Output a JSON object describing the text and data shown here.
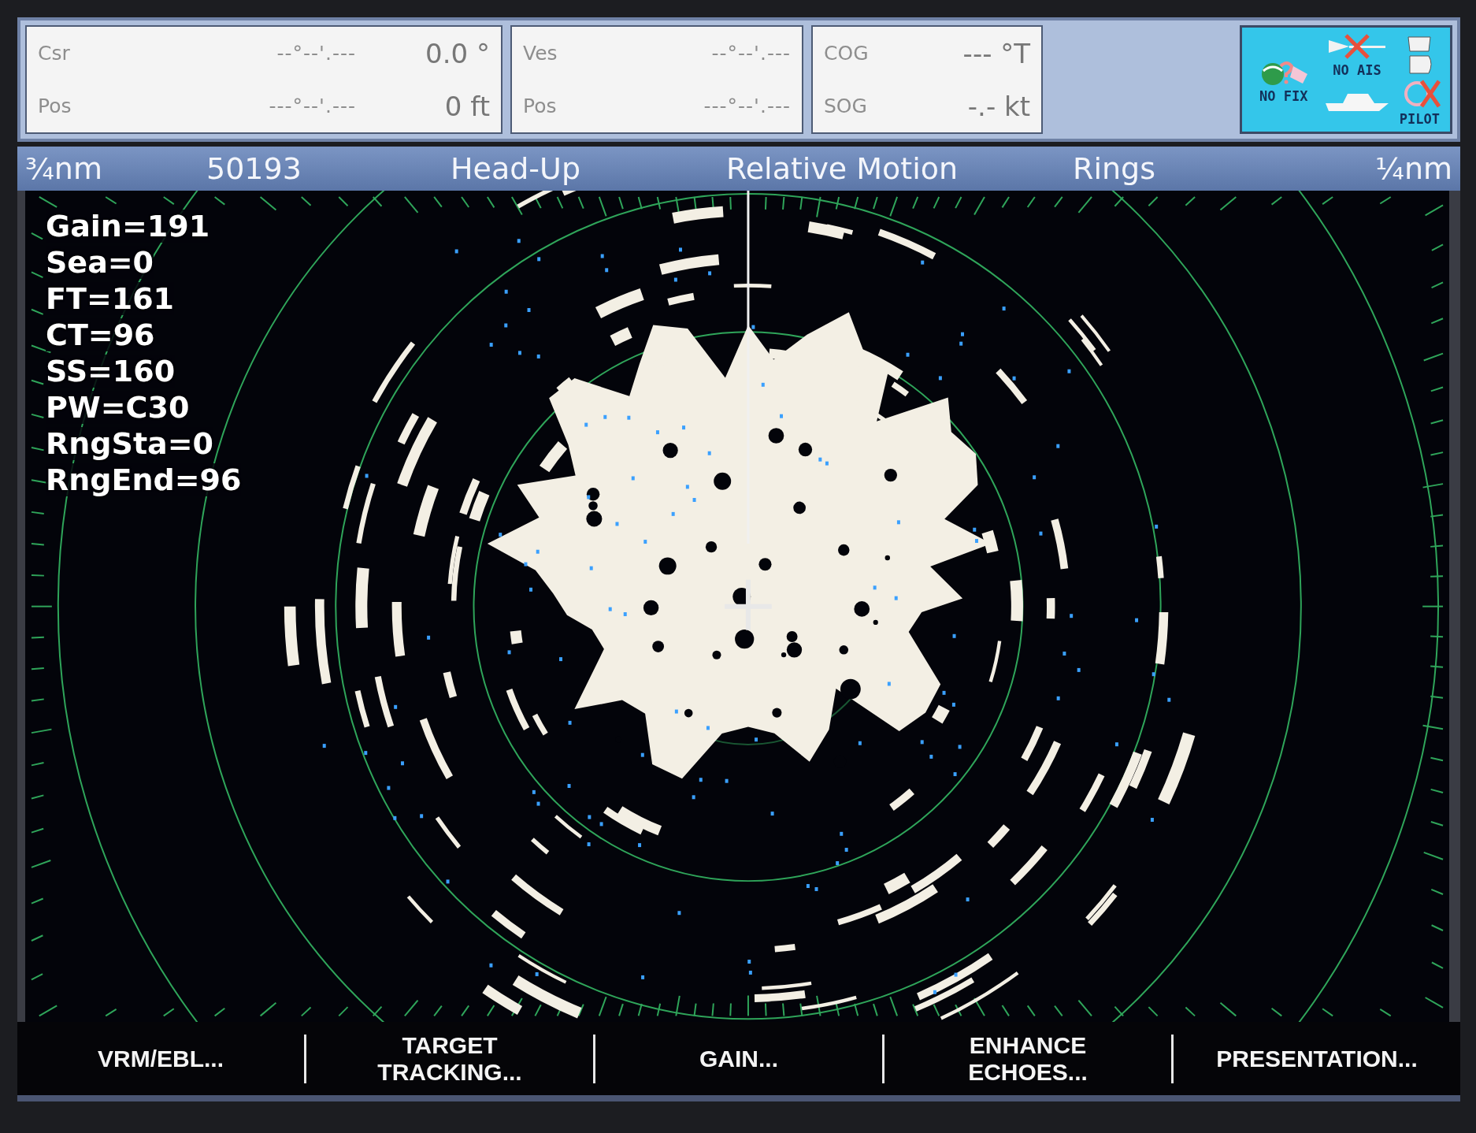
{
  "cursor_panel": {
    "rows": [
      {
        "label": "Csr",
        "position": "--°--'.---",
        "value": "0.0 °"
      },
      {
        "label": "Pos",
        "position": "---°--'.---",
        "value": "0 ft"
      }
    ]
  },
  "vessel_panel": {
    "rows": [
      {
        "label": "Ves",
        "position": "--°--'.---"
      },
      {
        "label": "Pos",
        "position": "---°--'.---"
      }
    ]
  },
  "course_panel": {
    "rows": [
      {
        "label": "COG",
        "value": "--- °T"
      },
      {
        "label": "SOG",
        "value": "-.- kt"
      }
    ]
  },
  "status_icons": [
    {
      "kind": "fix",
      "label": "NO FIX"
    },
    {
      "kind": "ais",
      "label": "NO AIS"
    },
    {
      "kind": "pilot",
      "label": "PILOT"
    }
  ],
  "range_bar": {
    "range": "¾nm",
    "counter": "50193",
    "orientation": "Head-Up",
    "motion": "Relative Motion",
    "rings": "Rings",
    "ring_interval": "¼nm"
  },
  "radar_settings": [
    "Gain=191",
    "Sea=0",
    "FT=161",
    "CT=96",
    "SS=160",
    "PW=C30",
    "RngSta=0",
    "RngEnd=96"
  ],
  "soft_keys": [
    {
      "label": "VRM/EBL..."
    },
    {
      "label": "TARGET\nTRACKING..."
    },
    {
      "label": "GAIN..."
    },
    {
      "label": "ENHANCE\nECHOES..."
    },
    {
      "label": "PRESENTATION..."
    }
  ]
}
